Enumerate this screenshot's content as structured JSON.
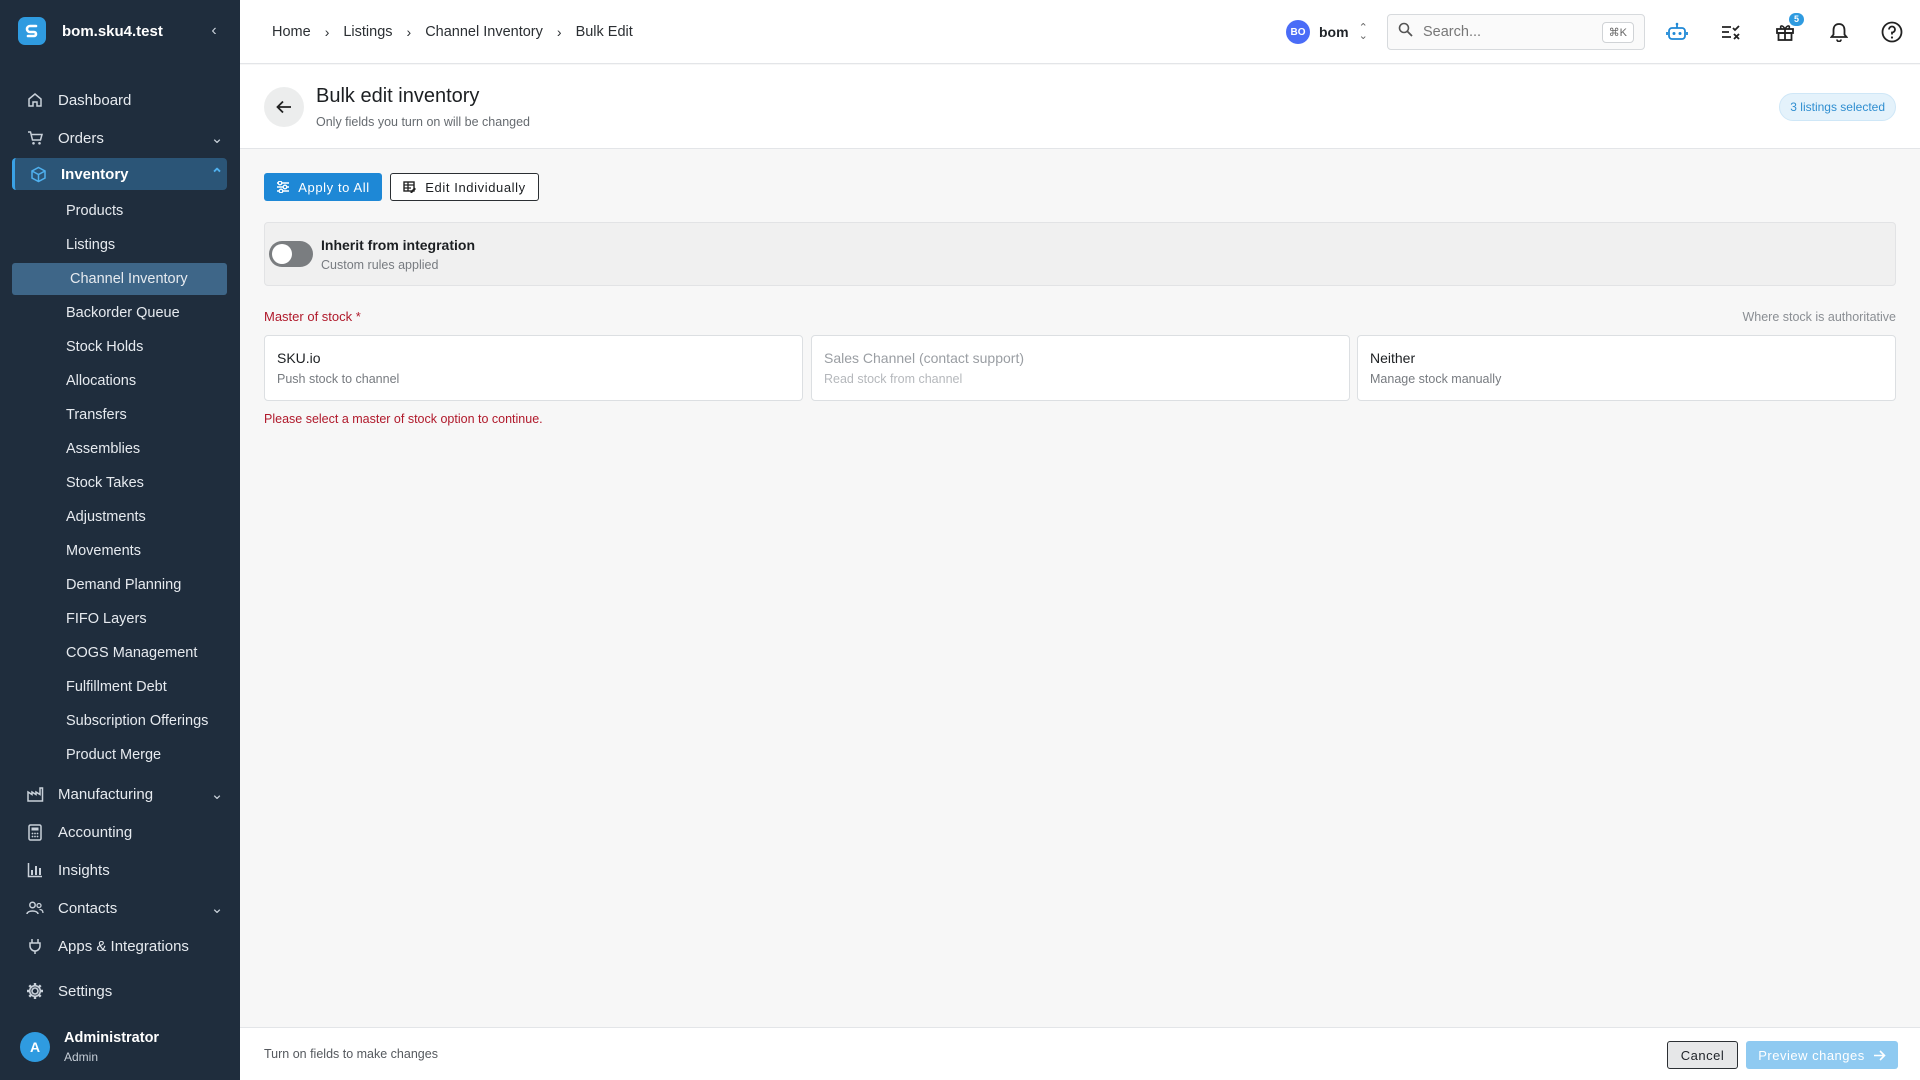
{
  "sidebar": {
    "org_title": "bom.sku4.test",
    "collapse_icon": "chevron-left-icon",
    "nav": {
      "dashboard": "Dashboard",
      "orders": "Orders",
      "inventory": "Inventory",
      "manufacturing": "Manufacturing",
      "accounting": "Accounting",
      "insights": "Insights",
      "contacts": "Contacts",
      "apps": "Apps & Integrations",
      "settings": "Settings"
    },
    "inventory_sub": [
      "Products",
      "Listings",
      "Channel Inventory",
      "Backorder Queue",
      "Stock Holds",
      "Allocations",
      "Transfers",
      "Assemblies",
      "Stock Takes",
      "Adjustments",
      "Movements",
      "Demand Planning",
      "FIFO Layers",
      "COGS Management",
      "Fulfillment Debt",
      "Subscription Offerings",
      "Product Merge"
    ],
    "active_sub": "Channel Inventory",
    "user": {
      "initial": "A",
      "name": "Administrator",
      "role": "Admin"
    }
  },
  "topbar": {
    "breadcrumbs": [
      "Home",
      "Listings",
      "Channel Inventory",
      "Bulk Edit"
    ],
    "org_badge": "BO",
    "org_name": "bom",
    "search_placeholder": "Search...",
    "search_shortcut": "⌘K",
    "gift_badge": "5"
  },
  "page": {
    "title": "Bulk edit inventory",
    "subtitle": "Only fields you turn on will be changed",
    "selected_pill": "3 listings selected"
  },
  "actions": {
    "apply_all": "Apply to All",
    "edit_individually": "Edit Individually"
  },
  "inherit": {
    "title": "Inherit from integration",
    "subtitle": "Custom rules applied",
    "enabled": false
  },
  "master_of_stock": {
    "label": "Master of stock *",
    "hint": "Where stock is authoritative",
    "options": [
      {
        "title": "SKU.io",
        "subtitle": "Push stock to channel",
        "disabled": false
      },
      {
        "title": "Sales Channel (contact support)",
        "subtitle": "Read stock from channel",
        "disabled": true
      },
      {
        "title": "Neither",
        "subtitle": "Manage stock manually",
        "disabled": false
      }
    ],
    "error": "Please select a master of stock option to continue."
  },
  "footer": {
    "hint": "Turn on fields to make changes",
    "cancel": "Cancel",
    "preview": "Preview changes"
  },
  "colors": {
    "sidebar_bg": "#1f2d3d",
    "accent": "#1e88d6",
    "error": "#b0192b"
  }
}
